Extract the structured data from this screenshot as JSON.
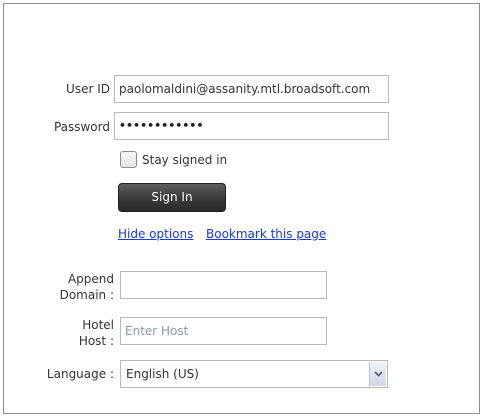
{
  "form": {
    "user_id_label": "User ID",
    "user_id_value": "paolomaldini@assanity.mtl.broadsoft.com",
    "password_label": "Password",
    "password_mask": "••••••••••••",
    "stay_signed_in_label": "Stay signed in",
    "stay_signed_in_checked": false,
    "sign_in_label": "Sign In",
    "hide_options_link": "Hide options",
    "bookmark_link": "Bookmark this page",
    "append_domain_label_1": "Append",
    "append_domain_label_2": "Domain :",
    "append_domain_value": "",
    "hotel_host_label_1": "Hotel",
    "hotel_host_label_2": "Host :",
    "hotel_host_placeholder": "Enter Host",
    "language_label": "Language :",
    "language_value": "English (US)"
  },
  "icons": {
    "select_arrow": "chevron-down-icon"
  },
  "colors": {
    "link": "#1a3cc8",
    "button_bg": "#3b3b3b",
    "placeholder": "#8a9aab"
  }
}
